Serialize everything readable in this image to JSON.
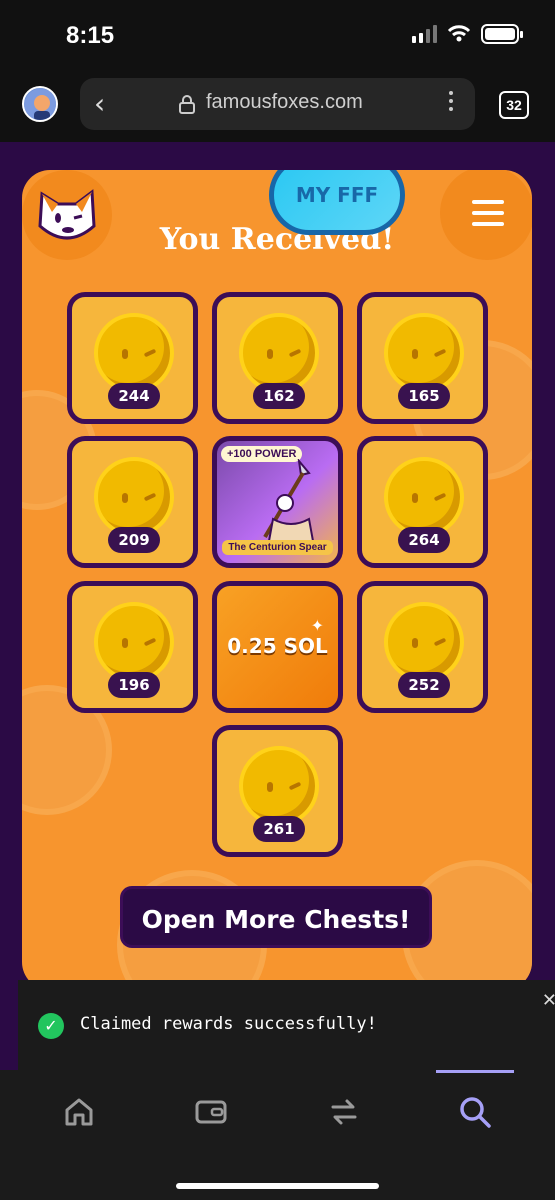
{
  "status_bar": {
    "time": "8:15",
    "icons": [
      "signal-icon",
      "wifi-icon",
      "battery-icon"
    ]
  },
  "browser": {
    "url": "famousfoxes.com",
    "tab_count": "32",
    "icons": [
      "profile-avatar",
      "back-icon",
      "lock-icon",
      "more-icon",
      "tabs-icon"
    ]
  },
  "header": {
    "title": "You Received!",
    "my_fff_label": "MY FFF",
    "menu_icon": "hamburger-icon",
    "logo_icon": "fox-logo"
  },
  "rewards": [
    {
      "type": "coin",
      "amount": "244"
    },
    {
      "type": "coin",
      "amount": "162"
    },
    {
      "type": "coin",
      "amount": "165"
    },
    {
      "type": "coin",
      "amount": "209"
    },
    {
      "type": "item",
      "power": "+100 POWER",
      "name": "The Centurion Spear"
    },
    {
      "type": "coin",
      "amount": "264"
    },
    {
      "type": "coin",
      "amount": "196"
    },
    {
      "type": "sol",
      "label": "0.25 SOL"
    },
    {
      "type": "coin",
      "amount": "252"
    },
    {
      "type": "coin",
      "amount": "261"
    }
  ],
  "open_more_button": "Open More Chests!",
  "toast": {
    "message": "Claimed rewards successfully!",
    "icon": "check-circle-icon",
    "close_icon": "close-icon"
  },
  "bottom_nav": {
    "items": [
      "home-icon",
      "wallet-icon",
      "swap-icon",
      "search-icon"
    ],
    "active": "search-icon"
  }
}
